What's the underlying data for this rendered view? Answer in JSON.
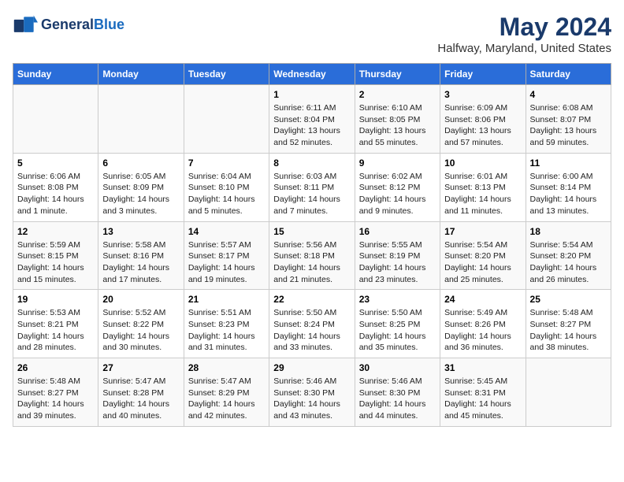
{
  "logo": {
    "line1": "General",
    "line2": "Blue"
  },
  "title": "May 2024",
  "subtitle": "Halfway, Maryland, United States",
  "days_of_week": [
    "Sunday",
    "Monday",
    "Tuesday",
    "Wednesday",
    "Thursday",
    "Friday",
    "Saturday"
  ],
  "weeks": [
    [
      {
        "day": "",
        "info": ""
      },
      {
        "day": "",
        "info": ""
      },
      {
        "day": "",
        "info": ""
      },
      {
        "day": "1",
        "info": "Sunrise: 6:11 AM\nSunset: 8:04 PM\nDaylight: 13 hours and 52 minutes."
      },
      {
        "day": "2",
        "info": "Sunrise: 6:10 AM\nSunset: 8:05 PM\nDaylight: 13 hours and 55 minutes."
      },
      {
        "day": "3",
        "info": "Sunrise: 6:09 AM\nSunset: 8:06 PM\nDaylight: 13 hours and 57 minutes."
      },
      {
        "day": "4",
        "info": "Sunrise: 6:08 AM\nSunset: 8:07 PM\nDaylight: 13 hours and 59 minutes."
      }
    ],
    [
      {
        "day": "5",
        "info": "Sunrise: 6:06 AM\nSunset: 8:08 PM\nDaylight: 14 hours and 1 minute."
      },
      {
        "day": "6",
        "info": "Sunrise: 6:05 AM\nSunset: 8:09 PM\nDaylight: 14 hours and 3 minutes."
      },
      {
        "day": "7",
        "info": "Sunrise: 6:04 AM\nSunset: 8:10 PM\nDaylight: 14 hours and 5 minutes."
      },
      {
        "day": "8",
        "info": "Sunrise: 6:03 AM\nSunset: 8:11 PM\nDaylight: 14 hours and 7 minutes."
      },
      {
        "day": "9",
        "info": "Sunrise: 6:02 AM\nSunset: 8:12 PM\nDaylight: 14 hours and 9 minutes."
      },
      {
        "day": "10",
        "info": "Sunrise: 6:01 AM\nSunset: 8:13 PM\nDaylight: 14 hours and 11 minutes."
      },
      {
        "day": "11",
        "info": "Sunrise: 6:00 AM\nSunset: 8:14 PM\nDaylight: 14 hours and 13 minutes."
      }
    ],
    [
      {
        "day": "12",
        "info": "Sunrise: 5:59 AM\nSunset: 8:15 PM\nDaylight: 14 hours and 15 minutes."
      },
      {
        "day": "13",
        "info": "Sunrise: 5:58 AM\nSunset: 8:16 PM\nDaylight: 14 hours and 17 minutes."
      },
      {
        "day": "14",
        "info": "Sunrise: 5:57 AM\nSunset: 8:17 PM\nDaylight: 14 hours and 19 minutes."
      },
      {
        "day": "15",
        "info": "Sunrise: 5:56 AM\nSunset: 8:18 PM\nDaylight: 14 hours and 21 minutes."
      },
      {
        "day": "16",
        "info": "Sunrise: 5:55 AM\nSunset: 8:19 PM\nDaylight: 14 hours and 23 minutes."
      },
      {
        "day": "17",
        "info": "Sunrise: 5:54 AM\nSunset: 8:20 PM\nDaylight: 14 hours and 25 minutes."
      },
      {
        "day": "18",
        "info": "Sunrise: 5:54 AM\nSunset: 8:20 PM\nDaylight: 14 hours and 26 minutes."
      }
    ],
    [
      {
        "day": "19",
        "info": "Sunrise: 5:53 AM\nSunset: 8:21 PM\nDaylight: 14 hours and 28 minutes."
      },
      {
        "day": "20",
        "info": "Sunrise: 5:52 AM\nSunset: 8:22 PM\nDaylight: 14 hours and 30 minutes."
      },
      {
        "day": "21",
        "info": "Sunrise: 5:51 AM\nSunset: 8:23 PM\nDaylight: 14 hours and 31 minutes."
      },
      {
        "day": "22",
        "info": "Sunrise: 5:50 AM\nSunset: 8:24 PM\nDaylight: 14 hours and 33 minutes."
      },
      {
        "day": "23",
        "info": "Sunrise: 5:50 AM\nSunset: 8:25 PM\nDaylight: 14 hours and 35 minutes."
      },
      {
        "day": "24",
        "info": "Sunrise: 5:49 AM\nSunset: 8:26 PM\nDaylight: 14 hours and 36 minutes."
      },
      {
        "day": "25",
        "info": "Sunrise: 5:48 AM\nSunset: 8:27 PM\nDaylight: 14 hours and 38 minutes."
      }
    ],
    [
      {
        "day": "26",
        "info": "Sunrise: 5:48 AM\nSunset: 8:27 PM\nDaylight: 14 hours and 39 minutes."
      },
      {
        "day": "27",
        "info": "Sunrise: 5:47 AM\nSunset: 8:28 PM\nDaylight: 14 hours and 40 minutes."
      },
      {
        "day": "28",
        "info": "Sunrise: 5:47 AM\nSunset: 8:29 PM\nDaylight: 14 hours and 42 minutes."
      },
      {
        "day": "29",
        "info": "Sunrise: 5:46 AM\nSunset: 8:30 PM\nDaylight: 14 hours and 43 minutes."
      },
      {
        "day": "30",
        "info": "Sunrise: 5:46 AM\nSunset: 8:30 PM\nDaylight: 14 hours and 44 minutes."
      },
      {
        "day": "31",
        "info": "Sunrise: 5:45 AM\nSunset: 8:31 PM\nDaylight: 14 hours and 45 minutes."
      },
      {
        "day": "",
        "info": ""
      }
    ]
  ]
}
